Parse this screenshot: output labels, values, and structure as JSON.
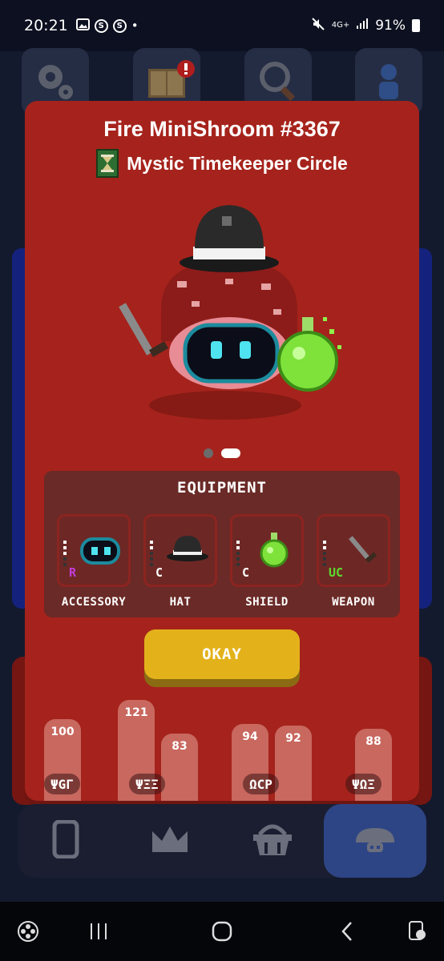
{
  "status_bar": {
    "time": "20:21",
    "network": "4G+",
    "battery": "91%"
  },
  "modal": {
    "title": "Fire MiniShroom #3367",
    "guild": "Mystic Timekeeper Circle",
    "carousel": {
      "count": 2,
      "active": 2
    },
    "equipment": {
      "title": "EQUIPMENT",
      "slots": [
        {
          "label": "ACCESSORY",
          "rarity": "R",
          "rarity_color": "#c43bd8"
        },
        {
          "label": "HAT",
          "rarity": "C",
          "rarity_color": "#ffffff"
        },
        {
          "label": "SHIELD",
          "rarity": "C",
          "rarity_color": "#ffffff"
        },
        {
          "label": "WEAPON",
          "rarity": "UC",
          "rarity_color": "#5bdc2e"
        }
      ]
    },
    "okay_label": "OKAY"
  },
  "background_stats": {
    "values": [
      "100",
      "121",
      "83",
      "94",
      "92",
      "88"
    ],
    "labels": [
      "ΨGΓ",
      "ΨΞΞ",
      "ΩCP",
      "ΨΩΞ"
    ]
  },
  "bottom_nav": {
    "items": [
      "phone-icon",
      "crown-icon",
      "basket-icon",
      "mushroom-icon"
    ],
    "active": "mushroom-icon"
  },
  "colors": {
    "modal_bg": "#a5231c",
    "equipment_bg": "#6a2a27",
    "okay_button": "#e3b21b",
    "nav_active": "#2e4585"
  }
}
